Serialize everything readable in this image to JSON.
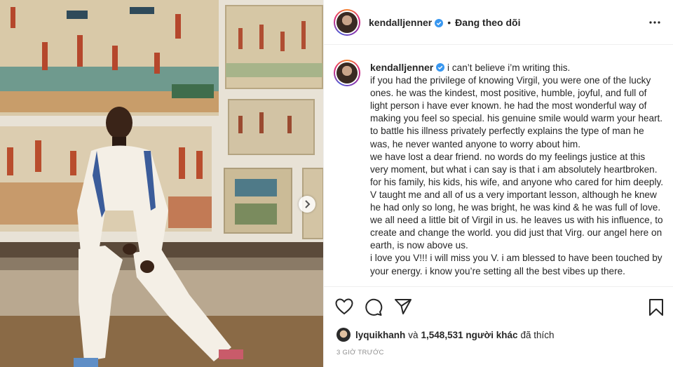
{
  "header": {
    "username": "kendalljenner",
    "separator": "•",
    "follow_state": "Đang theo dõi"
  },
  "caption": {
    "username": "kendalljenner",
    "lines": [
      "i can’t believe i’m writing this.",
      "if you had the privilege of knowing Virgil, you were one of the lucky ones. he was the kindest, most positive, humble, joyful, and full of light person i have ever known. he had the most wonderful way of making you feel so special. his genuine smile would warm your heart. to battle his illness privately perfectly explains the type of man he was, he never wanted anyone to worry about him.",
      "we have lost a dear friend. no words do my feelings justice at this very moment, but what i can say is that i am absolutely heartbroken. for his family, his kids, his wife, and anyone who cared for him deeply.",
      "V taught me and all of us a very important lesson, although he knew he had only so long, he was bright, he was kind & he was full of love. we all need a little bit of Virgil in us. he leaves us with his influence, to create and change the world. you did just that Virg. our angel here on earth, is now above us.",
      "i love you V!!! i will miss you V. i am blessed to have been touched by your energy. i know you’re setting all the best vibes up there."
    ]
  },
  "likes": {
    "liker": "lyquikhanh",
    "connector": "và",
    "count": "1,548,531 người khác",
    "suffix": "đã thích"
  },
  "timestamp": "3 GIỜ TRƯỚC",
  "icons": {
    "more": "more-options-icon",
    "verified": "verified-badge-icon",
    "like": "heart-icon",
    "comment": "comment-icon",
    "share": "share-icon",
    "save": "bookmark-icon",
    "next": "chevron-right-icon"
  },
  "colors": {
    "verified": "#3897f0",
    "text": "#262626",
    "muted": "#8e8e8e"
  }
}
